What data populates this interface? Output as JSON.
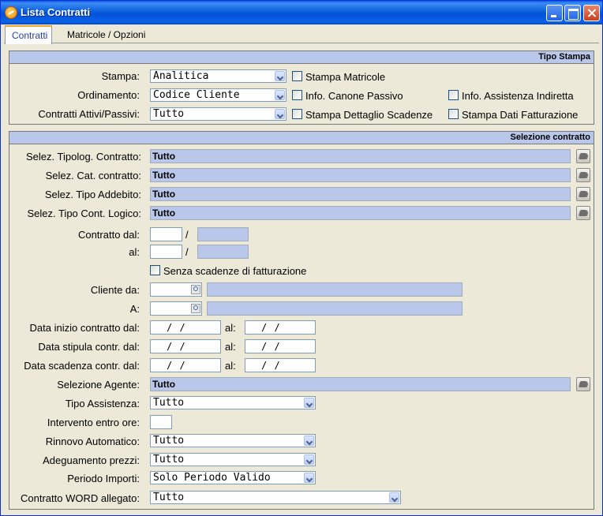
{
  "window": {
    "title": "Lista Contratti"
  },
  "tabs": [
    {
      "label": "Contratti"
    },
    {
      "label": "Matricole / Opzioni"
    }
  ],
  "tipo_stampa": {
    "header": "Tipo Stampa",
    "stampa": {
      "label": "Stampa:",
      "value": "Analitica"
    },
    "ordinamento": {
      "label": "Ordinamento:",
      "value": "Codice Cliente"
    },
    "attivi_passivi": {
      "label": "Contratti Attivi/Passivi:",
      "value": "Tutto"
    },
    "checkboxes": {
      "stampa_matricole": "Stampa Matricole",
      "info_canone": "Info. Canone Passivo",
      "info_assistenza": "Info. Assistenza Indiretta",
      "dettaglio_scadenze": "Stampa Dettaglio Scadenze",
      "dati_fatturazione": "Stampa Dati Fatturazione"
    }
  },
  "selezione": {
    "header": "Selezione contratto",
    "tipologia": {
      "label": "Selez. Tipolog. Contratto:",
      "value": "Tutto"
    },
    "categoria": {
      "label": "Selez. Cat. contratto:",
      "value": "Tutto"
    },
    "addebito": {
      "label": "Selez. Tipo Addebito:",
      "value": "Tutto"
    },
    "cont_logico": {
      "label": "Selez. Tipo Cont. Logico:",
      "value": "Tutto"
    },
    "contratto_dal": {
      "label": "Contratto dal:",
      "sep": "/"
    },
    "contratto_al": {
      "label": "al:",
      "sep": "/"
    },
    "senza_scadenze": "Senza scadenze di fatturazione",
    "cliente_da": {
      "label": "Cliente da:"
    },
    "cliente_a": {
      "label": "A:"
    },
    "data_inizio": {
      "label": "Data inizio contratto dal:",
      "from": "/  /",
      "al": "al:",
      "to": "/  /"
    },
    "data_stipula": {
      "label": "Data stipula contr. dal:",
      "from": "/  /",
      "al": "al:",
      "to": "/  /"
    },
    "data_scadenza": {
      "label": "Data scadenza contr. dal:",
      "from": "/  /",
      "al": "al:",
      "to": "/  /"
    },
    "agente": {
      "label": "Selezione Agente:",
      "value": "Tutto"
    },
    "tipo_assistenza": {
      "label": "Tipo Assistenza:",
      "value": "Tutto"
    },
    "intervento": {
      "label": "Intervento entro ore:"
    },
    "rinnovo": {
      "label": "Rinnovo Automatico:",
      "value": "Tutto"
    },
    "adeguamento": {
      "label": "Adeguamento prezzi:",
      "value": "Tutto"
    },
    "periodo": {
      "label": "Periodo Importi:",
      "value": "Solo Periodo Valido"
    },
    "word": {
      "label": "Contratto WORD allegato:",
      "value": "Tutto"
    }
  }
}
